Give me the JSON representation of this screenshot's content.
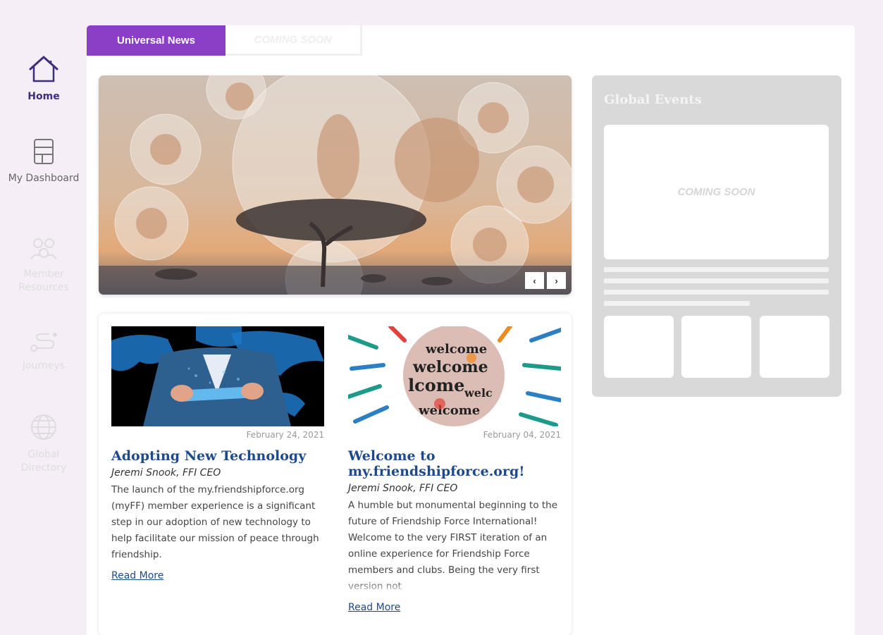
{
  "sidebar": {
    "items": [
      {
        "label": "Home",
        "icon": "home-icon",
        "state": "active"
      },
      {
        "label": "My Dashboard",
        "icon": "dashboard-icon",
        "state": "normal"
      },
      {
        "label": "Member Resources",
        "icon": "people-icon",
        "state": "disabled"
      },
      {
        "label": "Journeys",
        "icon": "route-icon",
        "state": "disabled"
      },
      {
        "label": "Global Directory",
        "icon": "globe-icon",
        "state": "disabled"
      }
    ]
  },
  "tabs": [
    {
      "label": "Universal News",
      "state": "active"
    },
    {
      "label": "COMING SOON",
      "state": "inactive"
    }
  ],
  "carousel": {
    "prev_label": "‹",
    "next_label": "›"
  },
  "articles": [
    {
      "date": "February 24, 2021",
      "title": "Adopting New Technology",
      "author": "Jeremi Snook, FFI CEO",
      "body": "The launch of the my.friendshipforce.org (myFF) member experience is a significant step in our adoption of new technology to help facilitate our mission of peace through friendship.",
      "more": "Read More"
    },
    {
      "date": "February 04, 2021",
      "title": "Welcome to my.friendshipforce.org!",
      "author": "Jeremi Snook, FFI CEO",
      "body": "A humble but monumental beginning to the future of Friendship Force International! Welcome to the very FIRST iteration of an online experience for Friendship Force members and clubs. Being the very first version not",
      "more": "Read More"
    }
  ],
  "events": {
    "title": "Global Events",
    "placeholder": "COMING SOON"
  },
  "colors": {
    "accent": "#8a3fc6",
    "link": "#1f4a8a",
    "background": "#f5eef7"
  }
}
